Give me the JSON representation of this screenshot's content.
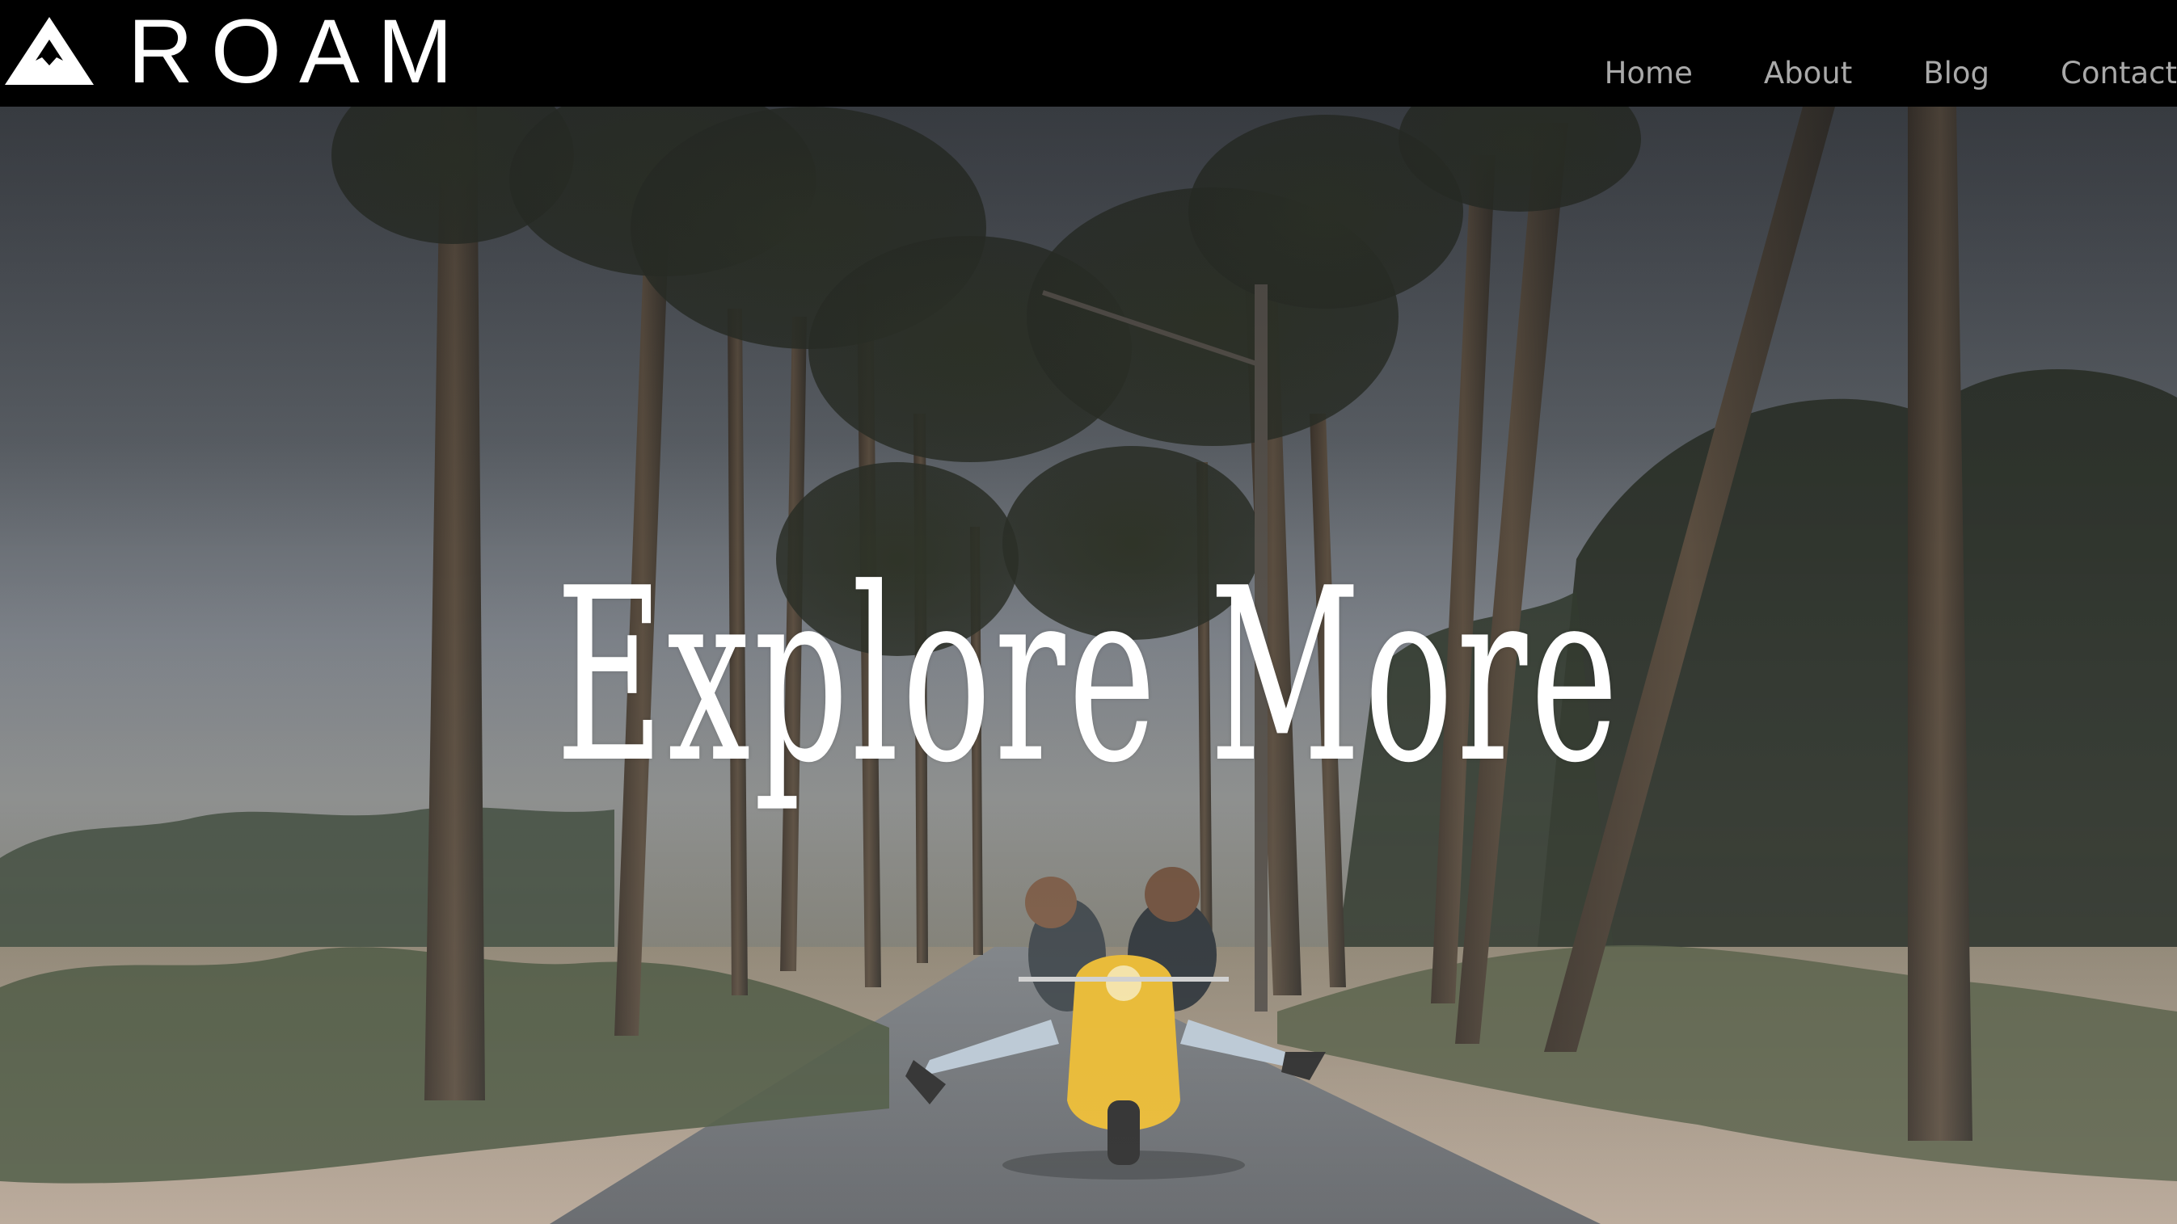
{
  "brand": {
    "name": "ROAM",
    "logo_icon": "mountain-icon"
  },
  "nav": {
    "items": [
      {
        "label": "Home"
      },
      {
        "label": "About"
      },
      {
        "label": "Blog"
      },
      {
        "label": "Contact"
      }
    ]
  },
  "hero": {
    "title": "Explore More",
    "image_alt": "Couple riding a yellow scooter down a palm-lined road"
  },
  "colors": {
    "header_bg": "#000000",
    "nav_text": "#a9a9a9",
    "hero_text": "#ffffff",
    "scooter": "#e8b830"
  }
}
